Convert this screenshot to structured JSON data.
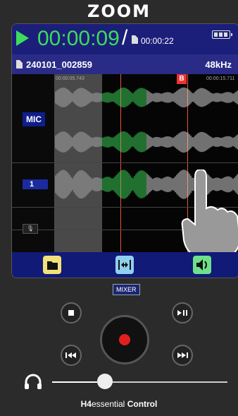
{
  "device": {
    "logo": "ZOOM"
  },
  "header": {
    "elapsed": "00:00:09",
    "separator": "/",
    "total": "00:00:22",
    "filename": "240101_002859",
    "sample_rate": "48kHz"
  },
  "timeline": {
    "marker_left": "00:00:05.743",
    "marker_right": "00:00:15.711",
    "b_marker": "B"
  },
  "tracks": {
    "mic_label": "MIC",
    "track1_label": "1"
  },
  "controls": {
    "mixer_label": "MIXER",
    "volume_level": 0.3
  },
  "footer": {
    "brand_main": "H4",
    "brand_sub": "essential",
    "brand_suffix": " Control"
  },
  "colors": {
    "accent_green": "#3ddc5a",
    "header_blue": "#1b1f7a",
    "record_red": "#e02020",
    "marker_red": "#e33"
  }
}
